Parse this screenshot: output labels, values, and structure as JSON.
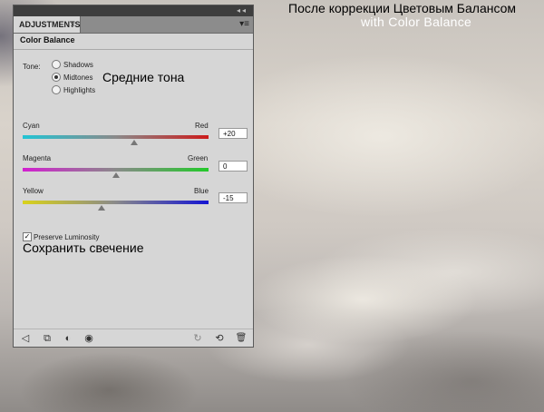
{
  "headings": {
    "line1": "После коррекции Цветовым Балансом",
    "line2": "with Color Balance"
  },
  "annotations": {
    "midtones": "Средние тона",
    "preserve": "Сохранить свечение"
  },
  "panel": {
    "tab_label": "ADJUSTMENTS",
    "tab_close": "×",
    "collapse_icon": "◂◂",
    "menu_icon": "▾≡",
    "title": "Color Balance",
    "tone": {
      "label": "Tone:",
      "options": [
        "Shadows",
        "Midtones",
        "Highlights"
      ],
      "selected": "Midtones"
    },
    "sliders": [
      {
        "left": "Cyan",
        "right": "Red",
        "value": "+20",
        "numeric": 20,
        "colors": [
          "#22c4d4",
          "#cc1b1b"
        ]
      },
      {
        "left": "Magenta",
        "right": "Green",
        "value": "0",
        "numeric": 0,
        "colors": [
          "#d21fd0",
          "#23c92a"
        ]
      },
      {
        "left": "Yellow",
        "right": "Blue",
        "value": "-15",
        "numeric": -15,
        "colors": [
          "#d9d21a",
          "#1414d2"
        ]
      }
    ],
    "slider_range": [
      -100,
      100
    ],
    "preserve": {
      "label": "Preserve Luminosity",
      "checked": true,
      "check_glyph": "✓"
    },
    "bottom_icons": {
      "back": "◁",
      "clip": "⧉",
      "visibility_prev": "◐",
      "eye": "◉",
      "loop": "↻",
      "reset": "⟲",
      "trash": "🗑"
    }
  }
}
